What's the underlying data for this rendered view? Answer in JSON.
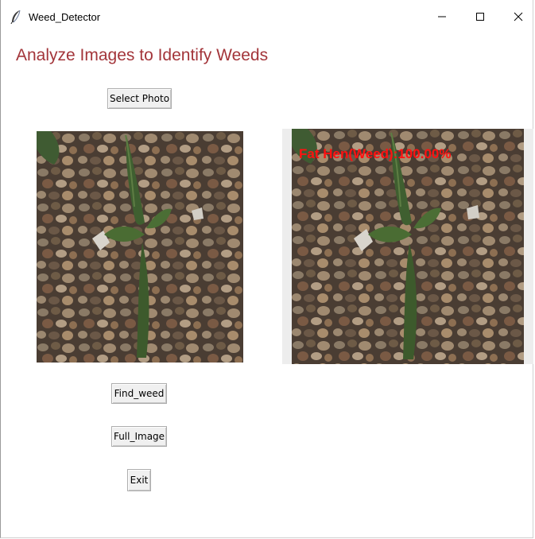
{
  "window": {
    "title": "Weed_Detector",
    "icon": "feather-icon",
    "controls": [
      "minimize-icon",
      "maximize-icon",
      "close-icon"
    ]
  },
  "heading": "Analyze Images to Identify Weeds",
  "buttons": {
    "select_photo": "Select Photo",
    "find_weed": "Find_weed",
    "full_image": "Full_Image",
    "exit": "Exit"
  },
  "result": {
    "label": "Fat Hen(Weed):100.00%"
  },
  "colors": {
    "heading": "#a3353a",
    "detection_label": "#ff1111",
    "button_face": "#f0f0f0"
  }
}
